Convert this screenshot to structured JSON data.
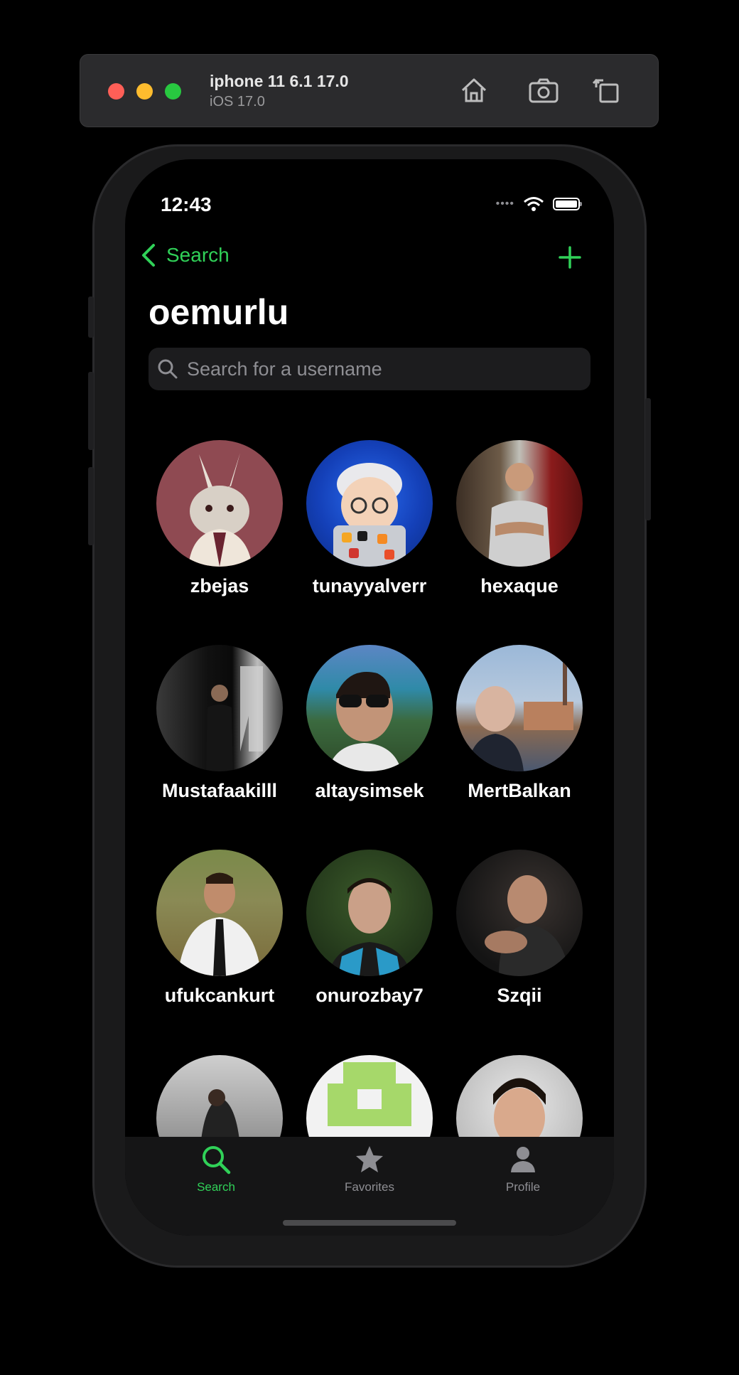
{
  "simulator": {
    "device_name": "iphone 11 6.1 17.0",
    "os_version": "iOS 17.0"
  },
  "status_bar": {
    "time": "12:43"
  },
  "nav": {
    "back_label": "Search",
    "title": "oemurlu"
  },
  "search": {
    "placeholder": "Search for a username",
    "value": ""
  },
  "users": [
    {
      "username": "zbejas"
    },
    {
      "username": "tunayyalverr"
    },
    {
      "username": "hexaque"
    },
    {
      "username": "Mustafaakilll"
    },
    {
      "username": "altaysimsek"
    },
    {
      "username": "MertBalkan"
    },
    {
      "username": "ufukcankurt"
    },
    {
      "username": "onurozbay7"
    },
    {
      "username": "Szqii"
    },
    {
      "username": ""
    },
    {
      "username": ""
    },
    {
      "username": ""
    }
  ],
  "tabs": [
    {
      "label": "Search",
      "icon": "search-icon",
      "active": true
    },
    {
      "label": "Favorites",
      "icon": "star-icon",
      "active": false
    },
    {
      "label": "Profile",
      "icon": "person-icon",
      "active": false
    }
  ],
  "colors": {
    "accent": "#30d158",
    "inactive": "#8e8e93",
    "background": "#000000"
  }
}
